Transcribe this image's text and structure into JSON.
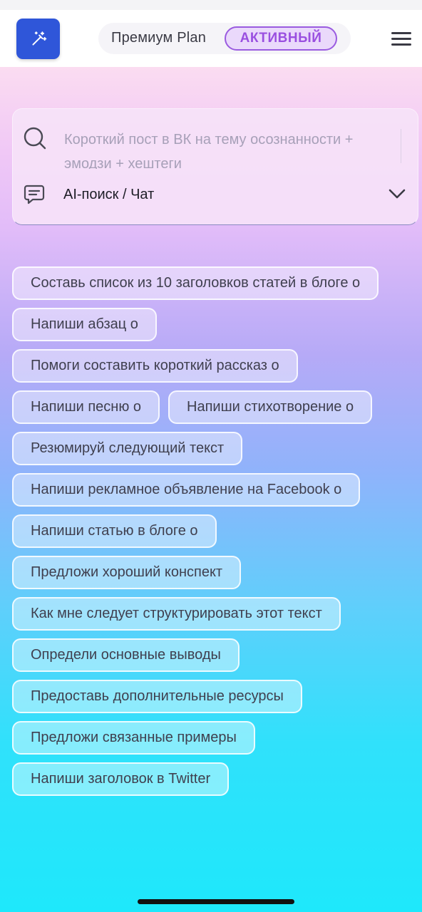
{
  "header": {
    "logo_icon": "magic-wand-icon",
    "plan_label": "Премиум Plan",
    "plan_status": "АКТИВНЫЙ",
    "menu_icon": "hamburger-menu-icon",
    "accent_color": "#2f56d9",
    "badge_color": "#9a4fe0"
  },
  "search": {
    "query": "Короткий пост в ВК на тему осознанности + эмодзи + хештеги",
    "mode_label": "AI-поиск / Чат",
    "search_icon": "search-icon",
    "mode_icon": "chat-icon",
    "dropdown_icon": "chevron-down-icon"
  },
  "suggestions": [
    "Составь список из 10 заголовков статей в блоге о",
    "Напиши абзац о",
    "Помоги составить короткий рассказ о",
    "Напиши песню о",
    "Напиши стихотворение о",
    "Резюмируй следующий текст",
    "Напиши рекламное объявление на Facebook о",
    "Напиши статью в блоге о",
    "Предложи хороший конспект",
    "Как мне следует структурировать этот текст",
    "Определи основные выводы",
    "Предоставь дополнительные ресурсы",
    "Предложи связанные примеры",
    "Напиши заголовок в Twitter"
  ]
}
